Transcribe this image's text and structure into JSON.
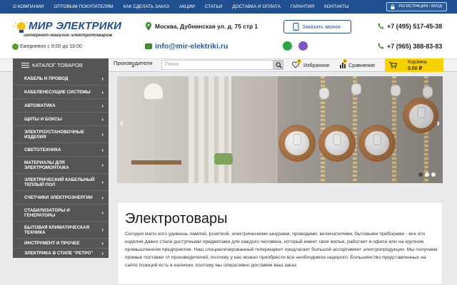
{
  "topmenu": {
    "items": [
      "О компании",
      "Оптовым покупателям",
      "Как сделать заказ",
      "Акции",
      "Статьи",
      "Доставка и оплата",
      "Гарантия",
      "Контакты"
    ],
    "login": "Регистрация / Вход"
  },
  "header": {
    "logo_title": "МИР ЭЛЕКТРИКИ",
    "logo_sub": "интернет-магазин электротоваров",
    "hours": "Ежедневно с 9:00 до 19:00",
    "address": "Москва, Дубнинская ул. д. 75 стр 1",
    "email": "info@mir-elektriki.ru",
    "callback": "Заказать звонок",
    "phone1": "+7 (495) 517-45-38",
    "phone2": "+7 (965) 388-83-83"
  },
  "nav": {
    "catalog": "Каталог товаров",
    "producers": "Производители",
    "search_placeholder": "Поиск",
    "favorites": "Избранное",
    "favorites_count": "0",
    "compare": "Сравнение",
    "compare_count": "0",
    "cart_label": "Корзина",
    "cart_sum": "0.00 ₽"
  },
  "sidebar": {
    "items": [
      {
        "label": "Кабель и провод"
      },
      {
        "label": "Кабеленесущие системы"
      },
      {
        "label": "Автоматика"
      },
      {
        "label": "Щиты и боксы"
      },
      {
        "label": "Электроустановочные изделия"
      },
      {
        "label": "Светотехника"
      },
      {
        "label": "Материалы для электромонтажа"
      },
      {
        "label": "Электрический кабельный теплый пол"
      },
      {
        "label": "Счетчики электроэнергии"
      },
      {
        "label": "Стабилизаторы и генераторы"
      },
      {
        "label": "Бытовая климатическая техника"
      },
      {
        "label": "Инструмент и прочее"
      },
      {
        "label": "Электрика в стиле \"ретро\""
      }
    ]
  },
  "slider": {
    "slide_count": 3,
    "active_slide": 1
  },
  "content": {
    "title": "Электротовары",
    "text": "Сегодня мало кого удивишь лампой, розеткой, электрическими шнурами, проводами, включателями, бытовыми приборами - все эти изделия давно стали доступными предметами для каждого человека, который имеет свое жилье, работает в офисе или на крупном промышленном предприятии. Наш специализированный гипермаркет предлагает большой ассортимент электропродукции. Мы получаем прямые поставки от производителей, поэтому у нас можно приобрести все необходимое недорого. Большинство представленных на сайте позиций есть в наличии, поэтому мы оперативно доставим ваш заказ."
  },
  "colors": {
    "topbar": "#1f4f8f",
    "sidebar": "#555555",
    "cart": "#f7d200",
    "accent_green": "#3c8d2e"
  }
}
